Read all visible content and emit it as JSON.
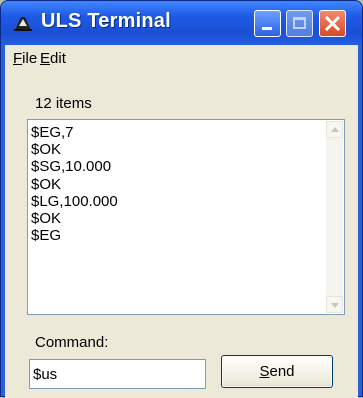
{
  "window": {
    "title": "ULS Terminal"
  },
  "menu": [
    {
      "accel": "F",
      "rest": "ile"
    },
    {
      "accel": "E",
      "rest": "dit"
    }
  ],
  "list": {
    "count_label": "12 items",
    "items": [
      "$EG,7",
      "$OK",
      "$SG,10.000",
      "$OK",
      "$LG,100.000",
      "$OK",
      "$EG"
    ]
  },
  "command": {
    "label": "Command:",
    "value": "$us"
  },
  "send_button": {
    "accel": "S",
    "rest": "end"
  },
  "colors": {
    "titlebar": "#1f5ae6",
    "client": "#ece9d8",
    "close_button": "#d8492a"
  }
}
